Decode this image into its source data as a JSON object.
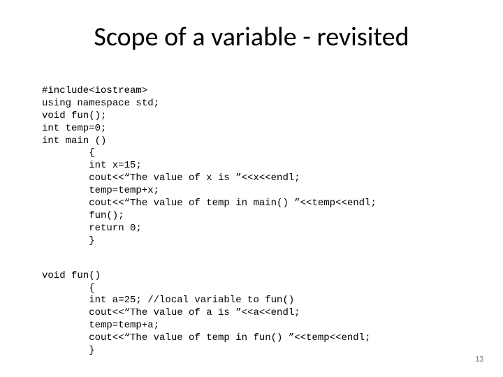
{
  "title": "Scope of a variable - revisited",
  "page_number": "13",
  "code_block1": {
    "l1": "#include<iostream>",
    "l2": "using namespace std;",
    "l3": "void fun();",
    "l4": "int temp=0;",
    "l5": "int main ()",
    "l6": "{",
    "l7": "int x=15;",
    "l8": "cout<<“The value of x is ”<<x<<endl;",
    "l9": "temp=temp+x;",
    "l10": "cout<<“The value of temp in main() ”<<temp<<endl;",
    "l11": "fun();",
    "l12": "return 0;",
    "l13": "}"
  },
  "code_block2": {
    "l1": "void fun()",
    "l2": "{",
    "l3": "int a=25; //local variable to fun()",
    "l4": "cout<<“The value of a is ”<<a<<endl;",
    "l5": "temp=temp+a;",
    "l6": "cout<<“The value of temp in fun() ”<<temp<<endl;",
    "l7": "}"
  }
}
